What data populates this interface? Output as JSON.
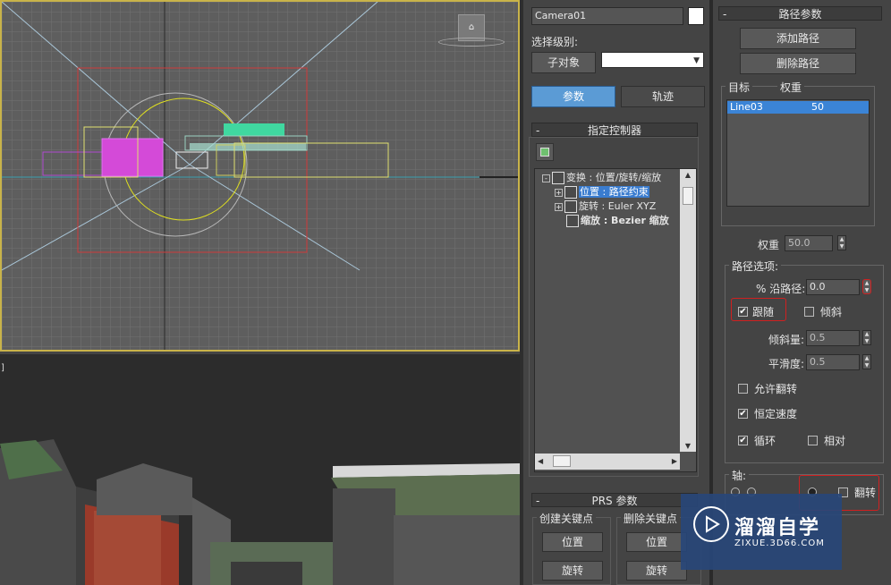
{
  "viewport_bottom": {
    "corner_mark": "]"
  },
  "modifier": {
    "object_name": "Camera01",
    "selection_level_label": "选择级别:",
    "sub_object_button": "子对象",
    "tab_params": "参数",
    "tab_trajectory": "轨迹"
  },
  "assign_controller": {
    "title": "指定控制器",
    "tree": [
      {
        "label": "变换 : 位置/旋转/缩放",
        "expander": "-"
      },
      {
        "label": "位置 : 路径约束",
        "expander": "+",
        "selected": true
      },
      {
        "label": "旋转 : Euler XYZ",
        "expander": "+"
      },
      {
        "label": "缩放 : Bezier 缩放",
        "expander": "",
        "bold": true
      }
    ]
  },
  "prs": {
    "title": "PRS 参数",
    "create_key_title": "创建关键点",
    "delete_key_title": "删除关键点",
    "position_button": "位置",
    "rotation_button": "旋转"
  },
  "path_params": {
    "title": "路径参数",
    "add_path_button": "添加路径",
    "delete_path_button": "删除路径",
    "target_header": "目标",
    "weight_header": "权重",
    "paths": [
      {
        "target": "Line03",
        "weight": "50"
      }
    ],
    "weight_label": "权重",
    "weight_value": "50.0",
    "options_title": "路径选项:",
    "percent_along_label": "% 沿路径:",
    "percent_along_value": "0.0",
    "follow_label": "跟随",
    "follow_checked": "✔",
    "bank_label": "倾斜",
    "bank_amount_label": "倾斜量:",
    "bank_amount_value": "0.5",
    "smoothness_label": "平滑度:",
    "smoothness_value": "0.5",
    "allow_flip_label": "允许翻转",
    "constant_velocity_label": "恒定速度",
    "constant_velocity_checked": "✔",
    "loop_label": "循环",
    "loop_checked": "✔",
    "relative_label": "相对",
    "axis_title": "轴:",
    "flip_label": "翻转"
  },
  "watermark": {
    "title": "溜溜自学",
    "subtitle": "ZIXUE.3D66.COM"
  },
  "colors": {
    "accent": "#5b9bd5",
    "selection": "#3a7ccf",
    "highlight_box": "#d02020",
    "viewport_active_border": "#c9b34a"
  }
}
